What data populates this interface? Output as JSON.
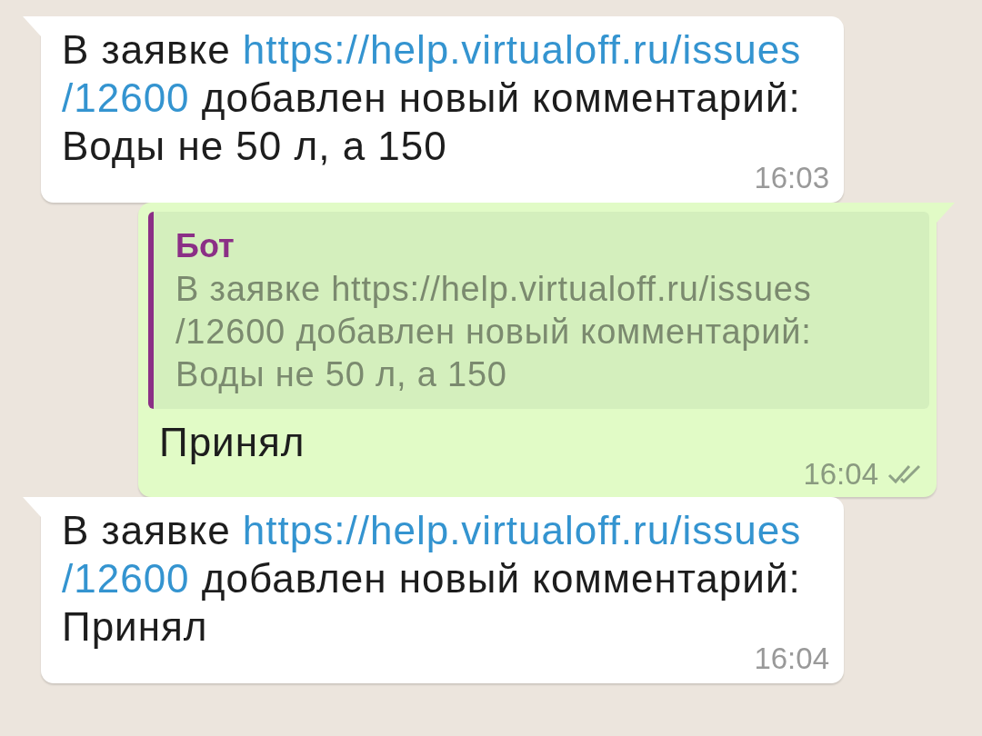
{
  "messages": [
    {
      "kind": "incoming",
      "parts": [
        {
          "text": "В заявке "
        },
        {
          "text": "https://help.virtualoff.ru/issues",
          "link": true
        },
        {
          "text": "/12600",
          "link": true
        },
        {
          "text": " добавлен новый комментарий: Воды не 50 л, а 150"
        }
      ],
      "time": "16:03"
    },
    {
      "kind": "outgoing",
      "quote": {
        "author": "Бот",
        "text": "В заявке https://help.virtualoff.ru/issues/12600 добавлен новый комментарий: Воды не 50 л, а 150"
      },
      "parts": [
        {
          "text": "Принял"
        }
      ],
      "time": "16:04",
      "read": true
    },
    {
      "kind": "incoming",
      "parts": [
        {
          "text": "В заявке "
        },
        {
          "text": "https://help.virtualoff.ru/issues",
          "link": true
        },
        {
          "text": "/12600",
          "link": true
        },
        {
          "text": " добавлен новый комментарий: Принял"
        }
      ],
      "time": "16:04"
    }
  ]
}
